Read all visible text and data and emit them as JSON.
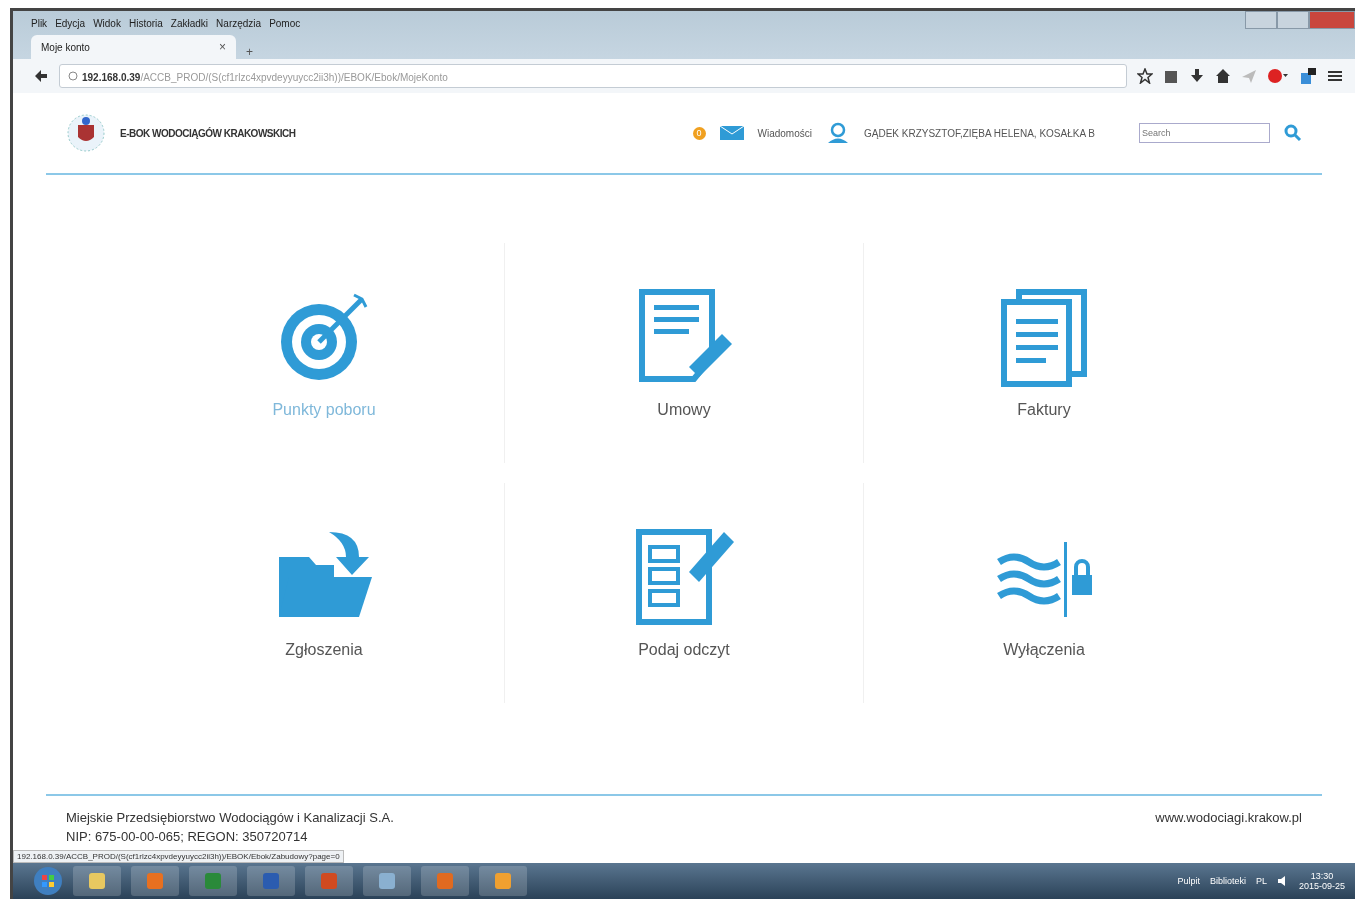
{
  "browser": {
    "menu": [
      "Plik",
      "Edycja",
      "Widok",
      "Historia",
      "Zakładki",
      "Narzędzia",
      "Pomoc"
    ],
    "tab": {
      "title": "Moje konto",
      "close": "×",
      "new_tab": "+"
    },
    "url": {
      "host": "192.168.0.39",
      "path": "/ACCB_PROD/(S(cf1rlzc4xpvdeyyuycc2ii3h))/EBOK/Ebok/MojeKonto"
    }
  },
  "header": {
    "brand": "E-BOK WODOCIĄGÓW KRAKOWSKICH",
    "messages_count": "0",
    "messages": "Wiadomości",
    "user": "GĄDEK KRZYSZTOF,ZIĘBA HELENA, KOSAŁKA B",
    "search": {
      "placeholder": "Search"
    }
  },
  "tiles": [
    {
      "label": "Punkty poboru",
      "kind": "target",
      "disabled": true
    },
    {
      "label": "Umowy",
      "kind": "contract",
      "disabled": false
    },
    {
      "label": "Faktury",
      "kind": "invoices",
      "disabled": false
    },
    {
      "label": "Zgłoszenia",
      "kind": "folder",
      "disabled": false
    },
    {
      "label": "Podaj odczyt",
      "kind": "form",
      "disabled": false
    },
    {
      "label": "Wyłączenia",
      "kind": "water-lock",
      "disabled": false
    }
  ],
  "footer": {
    "company": "Miejskie Przedsiębiorstwo Wodociągów i Kanalizacji S.A.",
    "ids": "NIP: 675-00-00-065; REGON: 350720714",
    "website": "www.wodociagi.krakow.pl"
  },
  "status_url": "192.168.0.39/ACCB_PROD/(S(cf1rlzc4xpvdeyyuycc2ii3h))/EBOK/Ebok/Zabudowy?page=0",
  "taskbar": {
    "toolbar": "Pulpit",
    "library": "Biblioteki",
    "language": "PL",
    "time": "13:30",
    "date": "2015-09-25"
  }
}
